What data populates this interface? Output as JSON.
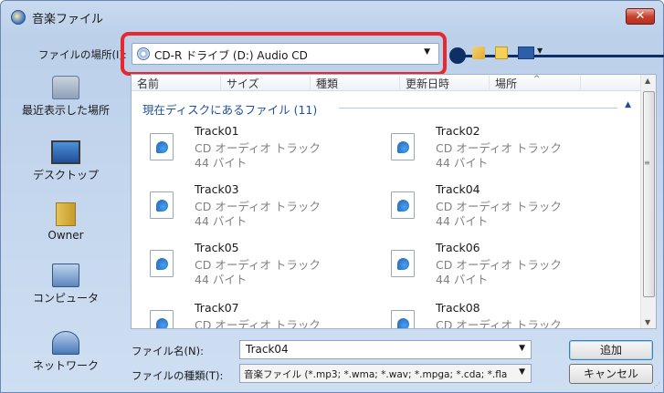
{
  "window": {
    "title": "音楽ファイル",
    "close_label": "✕"
  },
  "location": {
    "label": "ファイルの場所(I):",
    "value": "CD-R ドライブ (D:) Audio CD"
  },
  "toolbar": {
    "icons": [
      "up-folder-icon",
      "new-folder-icon",
      "views-menu-icon"
    ]
  },
  "sidebar": {
    "items": [
      {
        "label": "最近表示した場所",
        "icon": "recent-places-icon"
      },
      {
        "label": "デスクトップ",
        "icon": "desktop-icon"
      },
      {
        "label": "Owner",
        "icon": "user-folder-icon"
      },
      {
        "label": "コンピュータ",
        "icon": "computer-icon"
      },
      {
        "label": "ネットワーク",
        "icon": "network-icon"
      }
    ]
  },
  "columns": [
    "名前",
    "サイズ",
    "種類",
    "更新日時",
    "場所"
  ],
  "group": {
    "title": "現在ディスクにあるファイル (11)"
  },
  "files": [
    {
      "name": "Track01",
      "type": "CD オーディオ トラック",
      "size": "44 バイト"
    },
    {
      "name": "Track02",
      "type": "CD オーディオ トラック",
      "size": "44 バイト"
    },
    {
      "name": "Track03",
      "type": "CD オーディオ トラック",
      "size": "44 バイト"
    },
    {
      "name": "Track04",
      "type": "CD オーディオ トラック",
      "size": "44 バイト"
    },
    {
      "name": "Track05",
      "type": "CD オーディオ トラック",
      "size": "44 バイト"
    },
    {
      "name": "Track06",
      "type": "CD オーディオ トラック",
      "size": "44 バイト"
    },
    {
      "name": "Track07",
      "type": "CD オーディオ トラック",
      "size": ""
    },
    {
      "name": "Track08",
      "type": "CD オーディオ トラック",
      "size": ""
    }
  ],
  "filename": {
    "label": "ファイル名(N):",
    "value": "Track04"
  },
  "filetype": {
    "label": "ファイルの種類(T):",
    "value": "音楽ファイル (*.mp3; *.wma; *.wav; *.mpga; *.cda; *.fla"
  },
  "buttons": {
    "open": "追加",
    "cancel": "キャンセル"
  },
  "colors": {
    "highlight": "#e8272f",
    "callout": "#0d2f66"
  }
}
